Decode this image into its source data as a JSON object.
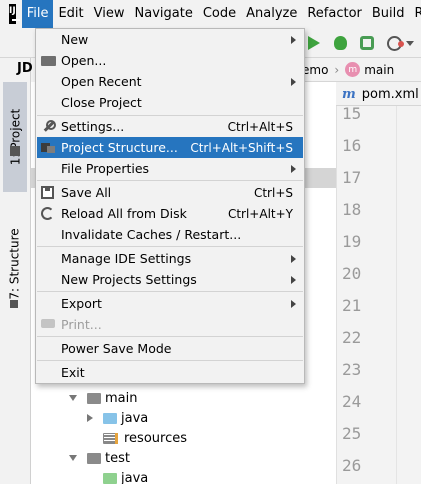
{
  "app": {
    "icon_label": "IJ"
  },
  "menubar": {
    "items": [
      {
        "label": "File",
        "active": true
      },
      {
        "label": "Edit"
      },
      {
        "label": "View"
      },
      {
        "label": "Navigate"
      },
      {
        "label": "Code"
      },
      {
        "label": "Analyze"
      },
      {
        "label": "Refactor"
      },
      {
        "label": "Build"
      },
      {
        "label": "R"
      }
    ]
  },
  "colors": {
    "accent": "#2675bf",
    "run_green": "#3ea33e",
    "menu_bg": "#f2f2f2"
  },
  "toolbar": {
    "icons": [
      "run-icon",
      "debug-icon",
      "coverage-icon",
      "profile-icon",
      "dropdown-arrow-icon"
    ]
  },
  "breadcrumb": {
    "project": "emo",
    "module": "main",
    "module_icon": "m"
  },
  "left_dock": {
    "project_tab": "1: Project",
    "structure_tab": "7: Structure",
    "project_header_label": "JD"
  },
  "editor": {
    "tab_label": "pom.xml",
    "tab_icon": "m",
    "line_numbers": [
      "15",
      "16",
      "17",
      "18",
      "19",
      "20",
      "21",
      "22",
      "23",
      "24",
      "25",
      "26"
    ]
  },
  "tree": {
    "rows": [
      {
        "label": "main",
        "kind": "folder-gray",
        "expanded": true
      },
      {
        "label": "java",
        "kind": "folder-blue",
        "expanded": false
      },
      {
        "label": "resources",
        "kind": "folder-resources"
      },
      {
        "label": "test",
        "kind": "folder-gray",
        "expanded": true
      },
      {
        "label": "java",
        "kind": "folder-green"
      }
    ]
  },
  "file_menu": {
    "items": [
      {
        "label": "New",
        "submenu": true
      },
      {
        "label": "Open...",
        "icon": "folder-icon"
      },
      {
        "label": "Open Recent",
        "submenu": true
      },
      {
        "label": "Close Project"
      },
      {
        "label": "Settings...",
        "icon": "wrench-icon",
        "shortcut": "Ctrl+Alt+S"
      },
      {
        "label": "Project Structure...",
        "icon": "project-structure-icon",
        "shortcut": "Ctrl+Alt+Shift+S",
        "selected": true
      },
      {
        "label": "File Properties",
        "submenu": true
      },
      {
        "label": "Save All",
        "icon": "save-icon",
        "shortcut": "Ctrl+S"
      },
      {
        "label": "Reload All from Disk",
        "icon": "reload-icon",
        "shortcut": "Ctrl+Alt+Y"
      },
      {
        "label": "Invalidate Caches / Restart..."
      },
      {
        "label": "Manage IDE Settings",
        "submenu": true
      },
      {
        "label": "New Projects Settings",
        "submenu": true
      },
      {
        "label": "Export",
        "submenu": true
      },
      {
        "label": "Print...",
        "icon": "print-icon",
        "disabled": true
      },
      {
        "label": "Power Save Mode"
      },
      {
        "label": "Exit"
      }
    ]
  }
}
